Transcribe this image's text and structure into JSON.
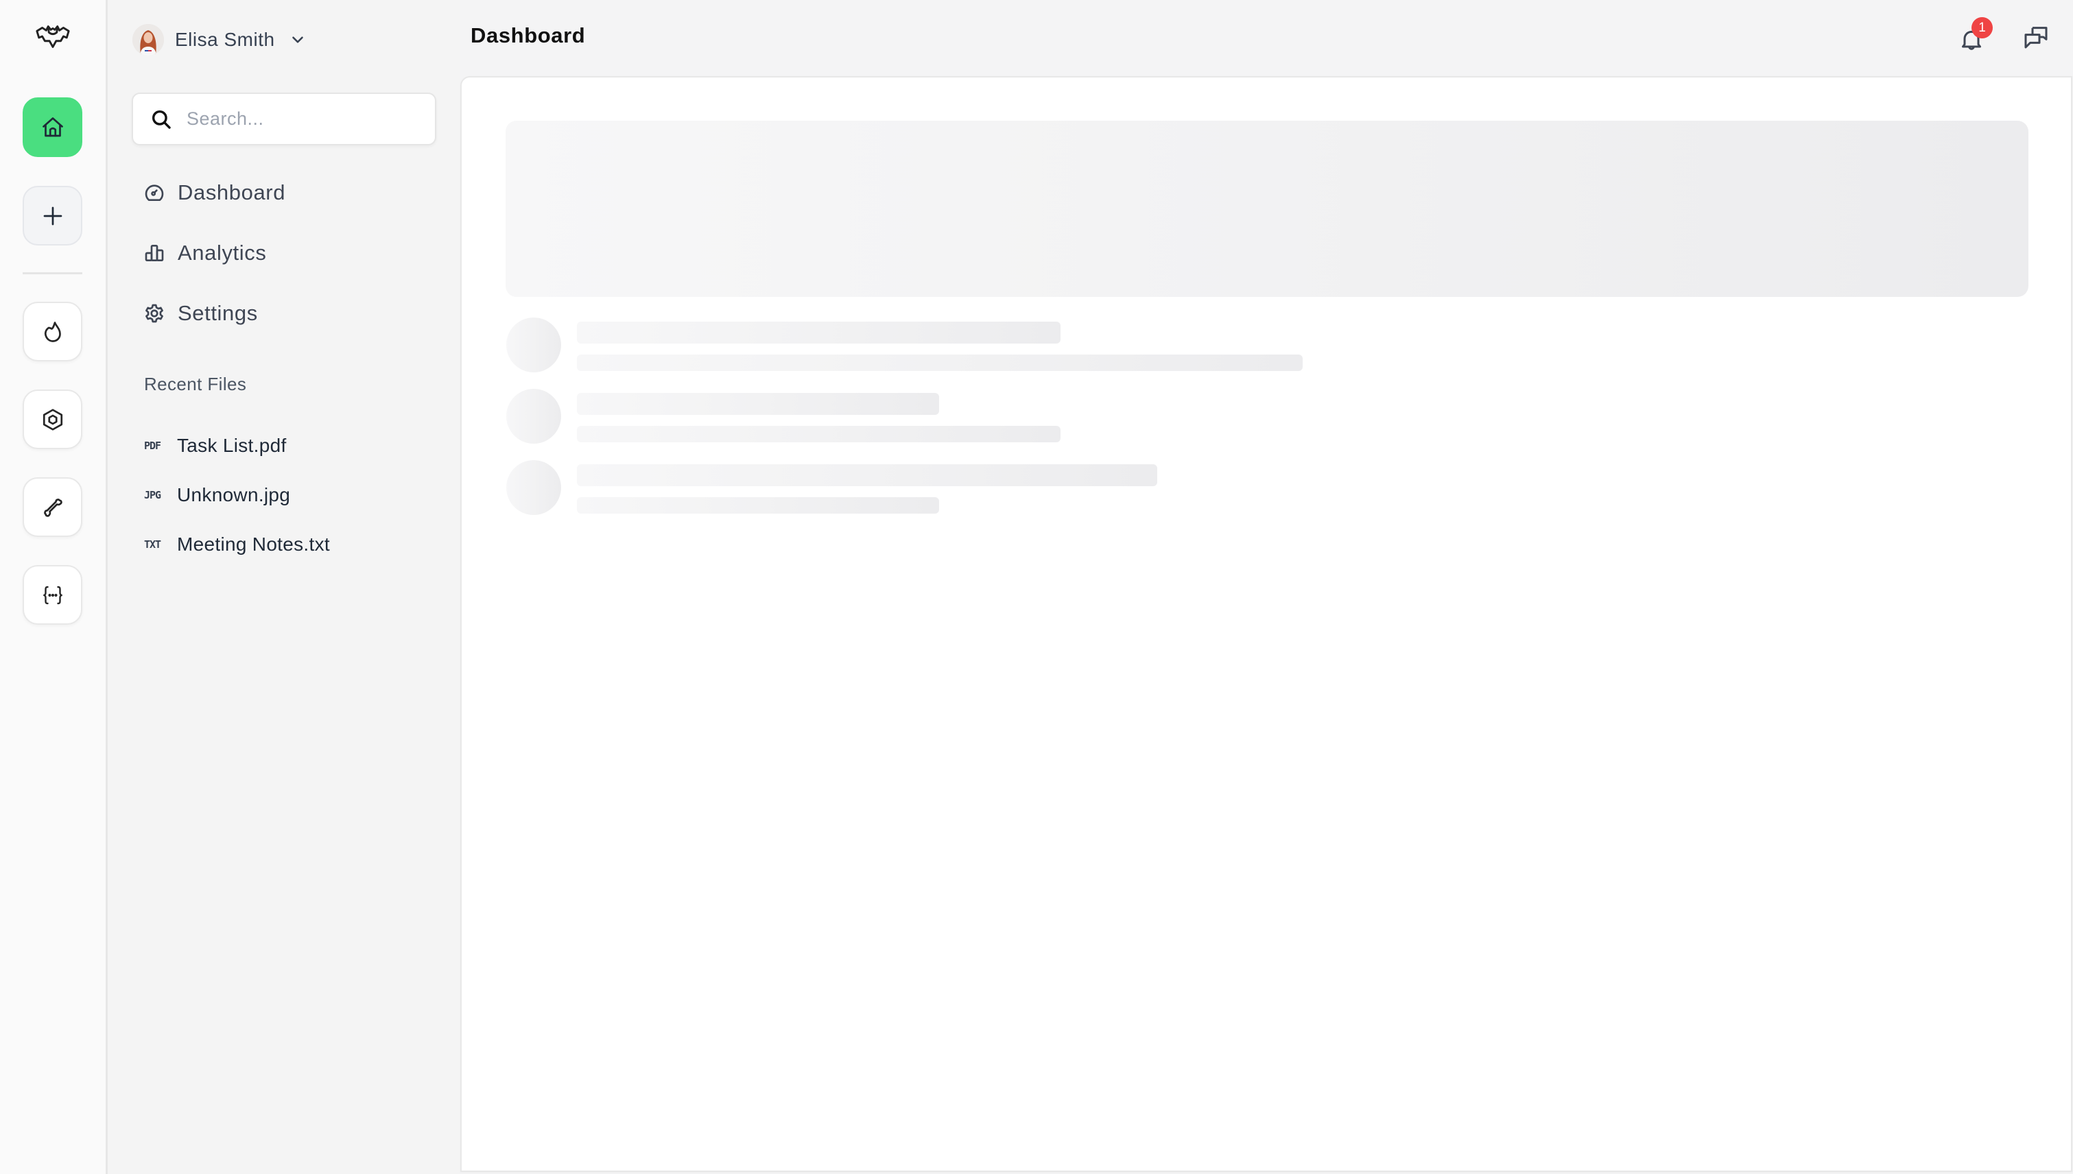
{
  "app": {
    "logo_icon": "bat-logo-icon",
    "accent_color": "#4ade80",
    "badge_color": "#ef4444"
  },
  "rail": {
    "items": [
      {
        "name": "home",
        "icon": "home-icon",
        "active": true
      },
      {
        "name": "add",
        "icon": "plus-icon",
        "active": false
      },
      {
        "name": "fire",
        "icon": "flame-icon",
        "active": false
      },
      {
        "name": "hexagon",
        "icon": "hexagon-nut-icon",
        "active": false
      },
      {
        "name": "bone",
        "icon": "bone-icon",
        "active": false
      },
      {
        "name": "code",
        "icon": "code-braces-icon",
        "active": false
      }
    ]
  },
  "sidebar": {
    "user": {
      "name": "Elisa Smith",
      "avatar": "avatar-photo"
    },
    "search": {
      "placeholder": "Search...",
      "value": ""
    },
    "nav": [
      {
        "label": "Dashboard",
        "icon": "gauge-icon"
      },
      {
        "label": "Analytics",
        "icon": "bar-chart-icon"
      },
      {
        "label": "Settings",
        "icon": "gear-icon"
      }
    ],
    "recent_files_title": "Recent Files",
    "recent_files": [
      {
        "type": "PDF",
        "name": "Task List.pdf"
      },
      {
        "type": "JPG",
        "name": "Unknown.jpg"
      },
      {
        "type": "TXT",
        "name": "Meeting Notes.txt"
      }
    ]
  },
  "header": {
    "title": "Dashboard",
    "notifications_count": "1",
    "notification_icon": "bell-icon",
    "messages_icon": "chat-bubbles-icon"
  },
  "main": {
    "state": "loading",
    "skeleton_rows": 3
  }
}
